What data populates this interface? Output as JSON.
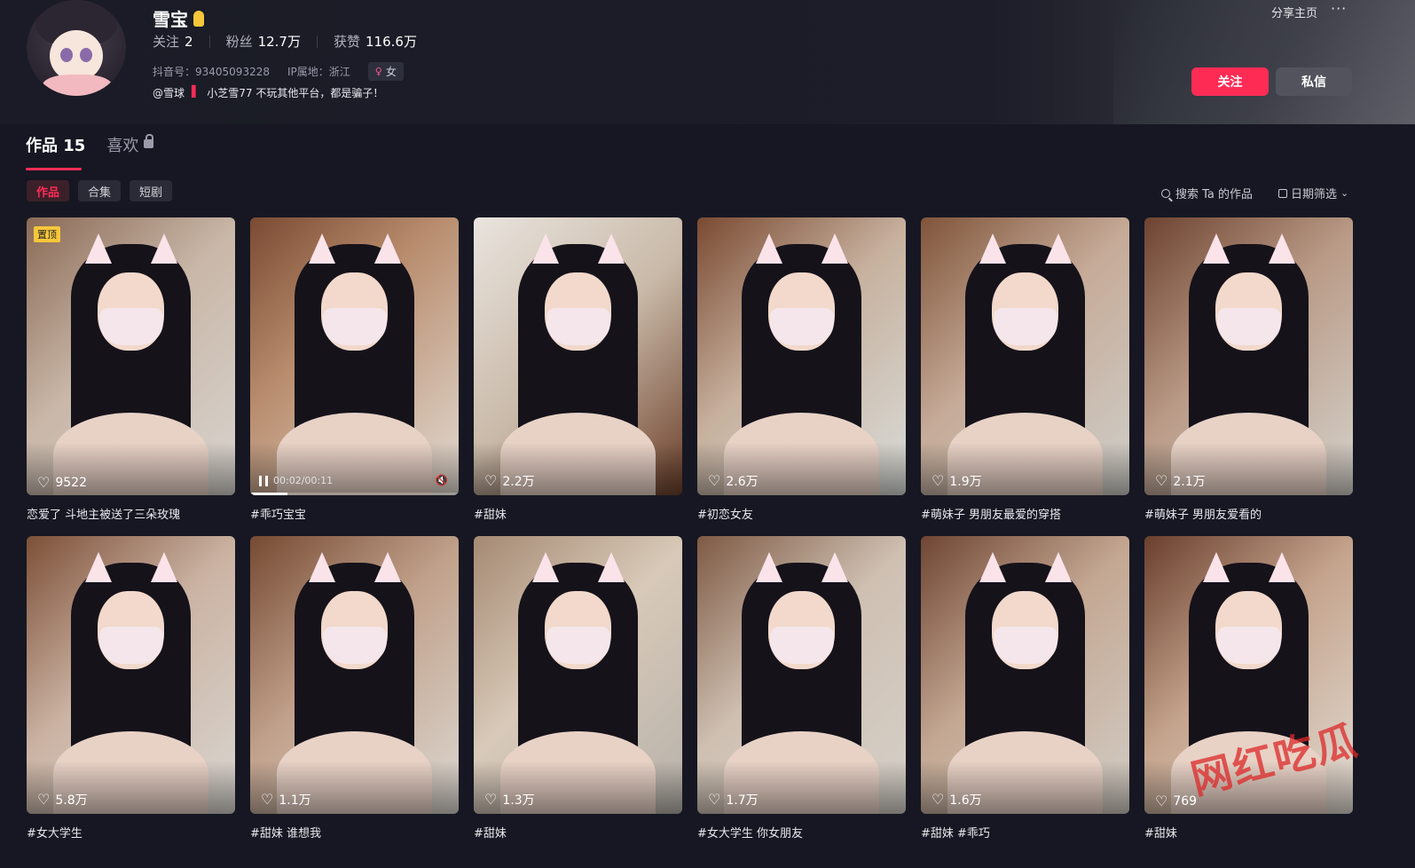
{
  "profile": {
    "name": "雪宝",
    "following_label": "关注",
    "following": "2",
    "followers_label": "粉丝",
    "followers": "12.7万",
    "likes_label": "获赞",
    "likes": "116.6万",
    "douyin_id": "抖音号：93405093228",
    "ip": "IP属地：浙江",
    "gender": "女",
    "bio_prefix": "@雪球",
    "bio_text": "小芝雪77 不玩其他平台，都是骗子！"
  },
  "header": {
    "share_label": "分享主页",
    "more_label": "···",
    "follow_label": "关注",
    "message_label": "私信"
  },
  "tabs": {
    "works_label": "作品 15",
    "likes_label": "喜欢"
  },
  "filters": {
    "chips": [
      "作品",
      "合集",
      "短剧"
    ],
    "search_label": "搜索 Ta 的作品",
    "date_label": "日期筛选"
  },
  "videos": [
    {
      "likes": "9522",
      "caption": "恋爱了 斗地主被送了三朵玫瑰",
      "pinned": "置顶"
    },
    {
      "likes": "",
      "caption": "#乖巧宝宝",
      "time": "00:02/00:11",
      "progress": 0.18
    },
    {
      "likes": "2.2万",
      "caption": "#甜妹"
    },
    {
      "likes": "2.6万",
      "caption": "#初恋女友"
    },
    {
      "likes": "1.9万",
      "caption": "#萌妹子 男朋友最爱的穿搭"
    },
    {
      "likes": "2.1万",
      "caption": "#萌妹子 男朋友爱看的"
    },
    {
      "likes": "5.8万",
      "caption": "#女大学生"
    },
    {
      "likes": "1.1万",
      "caption": "#甜妹 谁想我"
    },
    {
      "likes": "1.3万",
      "caption": "#甜妹"
    },
    {
      "likes": "1.7万",
      "caption": "#女大学生 你女朋友"
    },
    {
      "likes": "1.6万",
      "caption": "#甜妹 #乖巧"
    },
    {
      "likes": "769",
      "caption": "#甜妹"
    }
  ],
  "watermark": "网红吃瓜",
  "colors": {
    "accent": "#fe2c55",
    "background": "#161722"
  }
}
